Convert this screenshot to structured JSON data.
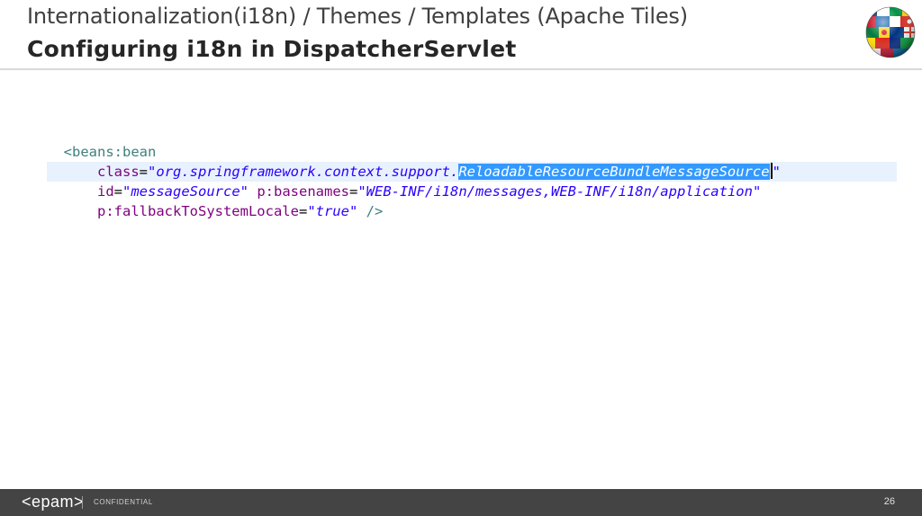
{
  "header": {
    "title_line1": "Internationalization(i18n) / Themes / Templates (Apache Tiles)",
    "title_line2": "Configuring i18n in DispatcherServlet",
    "logo_icon": "world-flags-globe-icon"
  },
  "code": {
    "line1": {
      "tag": "<beans:bean"
    },
    "line2": {
      "attr": "class",
      "eq": "=",
      "open_quote": "\"",
      "value_prefix": "org.springframework.context.support.",
      "value_selected": "ReloadableResourceBundleMessageSource",
      "close_quote": "\""
    },
    "line3": {
      "attr1": "id",
      "eq1": "=",
      "value1": "\"messageSource\"",
      "attr2": "p:basenames",
      "eq2": "=",
      "value2": "\"WEB-INF/i18n/messages,WEB-INF/i18n/application\""
    },
    "line4": {
      "attr": "p:fallbackToSystemLocale",
      "eq": "=",
      "value": "\"true\"",
      "close": "/>"
    }
  },
  "footer": {
    "logo": "<epam>",
    "confidential": "CONFIDENTIAL",
    "page_number": "26"
  },
  "colors": {
    "footer_bg": "#444444",
    "selection": "#3399ff",
    "line_highlight": "#e8f2fe",
    "xml_tag": "#3f7f7f",
    "xml_attr": "#7f007f",
    "xml_string": "#2a00ff"
  }
}
